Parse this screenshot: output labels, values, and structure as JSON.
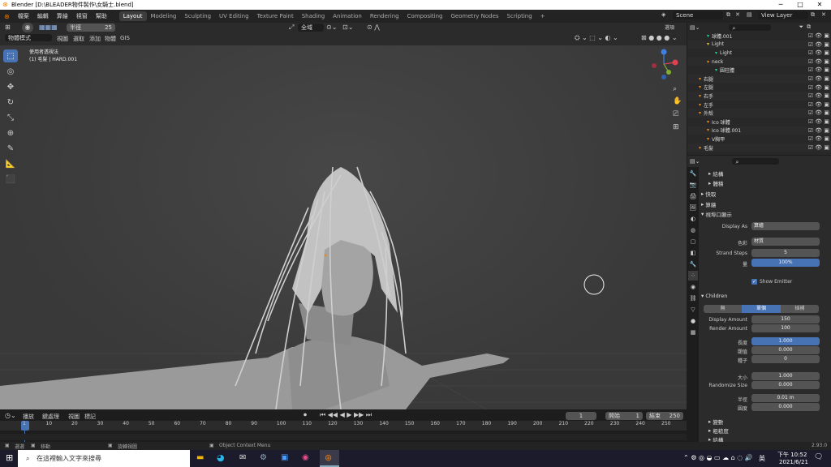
{
  "window": {
    "title": "Blender [D:\\BLEADER物件製作\\女騎士.blend]",
    "controls": [
      "─",
      "□",
      "✕"
    ]
  },
  "topbar": {
    "menus": [
      "檔案",
      "編輯",
      "算繪",
      "視窗",
      "幫助"
    ],
    "workspaces": [
      "Layout",
      "Modeling",
      "Sculpting",
      "UV Editing",
      "Texture Paint",
      "Shading",
      "Animation",
      "Rendering",
      "Compositing",
      "Geometry Nodes",
      "Scripting"
    ],
    "active_workspace": "Layout",
    "add_tab": "+",
    "scene_label": "Scene",
    "view_layer_label": "View Layer"
  },
  "viewport_header": {
    "radius_label": "半徑",
    "radius_value": "25",
    "orientation": "全域",
    "mode": "物體模式",
    "menus": [
      "視圖",
      "選取",
      "添加",
      "物體",
      "GIS"
    ],
    "select_label": "選項"
  },
  "viewport": {
    "view_name": "使用者透視法",
    "object_info": "(1) 毛髮 | HARD.001"
  },
  "outliner": {
    "items": [
      {
        "label": "球體.001",
        "indent": 1
      },
      {
        "label": "Light",
        "indent": 1
      },
      {
        "label": "Light",
        "indent": 2
      },
      {
        "label": "neck",
        "indent": 1
      },
      {
        "label": "圓柱體",
        "indent": 2
      },
      {
        "label": "右腿",
        "indent": 0
      },
      {
        "label": "左腿",
        "indent": 0
      },
      {
        "label": "右手",
        "indent": 0
      },
      {
        "label": "左手",
        "indent": 0
      },
      {
        "label": "外殼",
        "indent": 0
      },
      {
        "label": "Ico 球體",
        "indent": 1
      },
      {
        "label": "Ico 球體.001",
        "indent": 1
      },
      {
        "label": "V胸甲",
        "indent": 1
      },
      {
        "label": "毛髮",
        "indent": 0
      }
    ]
  },
  "properties": {
    "sections": {
      "jiegou": "結構",
      "tiji": "體積",
      "kuaiqu": "快取",
      "suanhui": "算繪",
      "viewport_display": "視埠口顯示",
      "children": "Children",
      "field_weights": "變數",
      "gradient": "粗糙度",
      "last": "結構"
    },
    "display_as_label": "Display As",
    "display_as_value": "算繪",
    "color_label": "色彩",
    "color_value": "材質",
    "strand_steps_label": "Strand Steps",
    "strand_steps_value": "5",
    "amount_label": "量",
    "amount_value": "100%",
    "show_emitter_label": "Show Emitter",
    "children_modes": [
      "無",
      "單個",
      "插補"
    ],
    "children_active": "單個",
    "display_amount_label": "Display Amount",
    "display_amount_value": "150",
    "render_amount_label": "Render Amount",
    "render_amount_value": "100",
    "length_label": "長度",
    "length_value": "1.000",
    "threshold_label": "閾值",
    "threshold_value": "0.000",
    "seed_label": "種子",
    "seed_value": "0",
    "size_label": "大小",
    "size_value": "1.000",
    "randomize_size_label": "Randomize Size",
    "randomize_size_value": "0.000",
    "radius_label": "半徑",
    "radius_value": "0.01 m",
    "roundness_label": "圓度",
    "roundness_value": "0.000"
  },
  "timeline": {
    "menus": [
      "播放",
      "鍵處理",
      "視圖",
      "標記"
    ],
    "current_frame": "1",
    "start_label": "開始",
    "start_value": "1",
    "end_label": "結束",
    "end_value": "250",
    "ticks": [
      "1",
      "10",
      "20",
      "30",
      "40",
      "50",
      "60",
      "70",
      "80",
      "90",
      "100",
      "110",
      "120",
      "130",
      "140",
      "150",
      "160",
      "170",
      "180",
      "190",
      "200",
      "210",
      "220",
      "230",
      "240",
      "250"
    ]
  },
  "statusbar": {
    "select": "選選",
    "move": "移動",
    "rotate": "旋轉視圖",
    "context": "Object Context Menu",
    "version": "2.93.0"
  },
  "taskbar": {
    "search_placeholder": "在這裡輸入文字來搜尋",
    "time": "下午 10:52",
    "date": "2021/6/21",
    "ime": "英"
  },
  "colors": {
    "accent": "#4772b3",
    "hair_object": "#e08a2a",
    "particle": "#2ad08a"
  }
}
